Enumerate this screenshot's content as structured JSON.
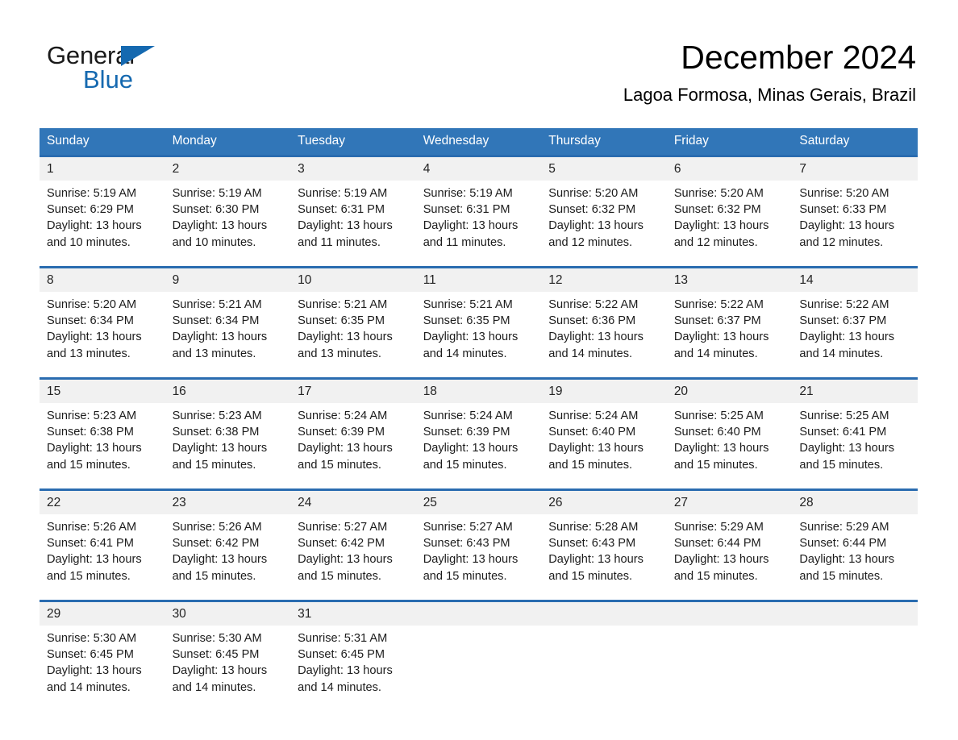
{
  "brand": {
    "name_part1": "General",
    "name_part2": "Blue",
    "accent_color": "#1569b0"
  },
  "header": {
    "month_title": "December 2024",
    "location": "Lagoa Formosa, Minas Gerais, Brazil"
  },
  "theme": {
    "header_blue": "#3176b8",
    "row_rule_blue": "#2a6cb0",
    "daynum_band": "#f1f1f1"
  },
  "weekday_headers": [
    "Sunday",
    "Monday",
    "Tuesday",
    "Wednesday",
    "Thursday",
    "Friday",
    "Saturday"
  ],
  "weeks": [
    [
      {
        "day": "1",
        "sunrise": "Sunrise: 5:19 AM",
        "sunset": "Sunset: 6:29 PM",
        "daylight": "Daylight: 13 hours and 10 minutes."
      },
      {
        "day": "2",
        "sunrise": "Sunrise: 5:19 AM",
        "sunset": "Sunset: 6:30 PM",
        "daylight": "Daylight: 13 hours and 10 minutes."
      },
      {
        "day": "3",
        "sunrise": "Sunrise: 5:19 AM",
        "sunset": "Sunset: 6:31 PM",
        "daylight": "Daylight: 13 hours and 11 minutes."
      },
      {
        "day": "4",
        "sunrise": "Sunrise: 5:19 AM",
        "sunset": "Sunset: 6:31 PM",
        "daylight": "Daylight: 13 hours and 11 minutes."
      },
      {
        "day": "5",
        "sunrise": "Sunrise: 5:20 AM",
        "sunset": "Sunset: 6:32 PM",
        "daylight": "Daylight: 13 hours and 12 minutes."
      },
      {
        "day": "6",
        "sunrise": "Sunrise: 5:20 AM",
        "sunset": "Sunset: 6:32 PM",
        "daylight": "Daylight: 13 hours and 12 minutes."
      },
      {
        "day": "7",
        "sunrise": "Sunrise: 5:20 AM",
        "sunset": "Sunset: 6:33 PM",
        "daylight": "Daylight: 13 hours and 12 minutes."
      }
    ],
    [
      {
        "day": "8",
        "sunrise": "Sunrise: 5:20 AM",
        "sunset": "Sunset: 6:34 PM",
        "daylight": "Daylight: 13 hours and 13 minutes."
      },
      {
        "day": "9",
        "sunrise": "Sunrise: 5:21 AM",
        "sunset": "Sunset: 6:34 PM",
        "daylight": "Daylight: 13 hours and 13 minutes."
      },
      {
        "day": "10",
        "sunrise": "Sunrise: 5:21 AM",
        "sunset": "Sunset: 6:35 PM",
        "daylight": "Daylight: 13 hours and 13 minutes."
      },
      {
        "day": "11",
        "sunrise": "Sunrise: 5:21 AM",
        "sunset": "Sunset: 6:35 PM",
        "daylight": "Daylight: 13 hours and 14 minutes."
      },
      {
        "day": "12",
        "sunrise": "Sunrise: 5:22 AM",
        "sunset": "Sunset: 6:36 PM",
        "daylight": "Daylight: 13 hours and 14 minutes."
      },
      {
        "day": "13",
        "sunrise": "Sunrise: 5:22 AM",
        "sunset": "Sunset: 6:37 PM",
        "daylight": "Daylight: 13 hours and 14 minutes."
      },
      {
        "day": "14",
        "sunrise": "Sunrise: 5:22 AM",
        "sunset": "Sunset: 6:37 PM",
        "daylight": "Daylight: 13 hours and 14 minutes."
      }
    ],
    [
      {
        "day": "15",
        "sunrise": "Sunrise: 5:23 AM",
        "sunset": "Sunset: 6:38 PM",
        "daylight": "Daylight: 13 hours and 15 minutes."
      },
      {
        "day": "16",
        "sunrise": "Sunrise: 5:23 AM",
        "sunset": "Sunset: 6:38 PM",
        "daylight": "Daylight: 13 hours and 15 minutes."
      },
      {
        "day": "17",
        "sunrise": "Sunrise: 5:24 AM",
        "sunset": "Sunset: 6:39 PM",
        "daylight": "Daylight: 13 hours and 15 minutes."
      },
      {
        "day": "18",
        "sunrise": "Sunrise: 5:24 AM",
        "sunset": "Sunset: 6:39 PM",
        "daylight": "Daylight: 13 hours and 15 minutes."
      },
      {
        "day": "19",
        "sunrise": "Sunrise: 5:24 AM",
        "sunset": "Sunset: 6:40 PM",
        "daylight": "Daylight: 13 hours and 15 minutes."
      },
      {
        "day": "20",
        "sunrise": "Sunrise: 5:25 AM",
        "sunset": "Sunset: 6:40 PM",
        "daylight": "Daylight: 13 hours and 15 minutes."
      },
      {
        "day": "21",
        "sunrise": "Sunrise: 5:25 AM",
        "sunset": "Sunset: 6:41 PM",
        "daylight": "Daylight: 13 hours and 15 minutes."
      }
    ],
    [
      {
        "day": "22",
        "sunrise": "Sunrise: 5:26 AM",
        "sunset": "Sunset: 6:41 PM",
        "daylight": "Daylight: 13 hours and 15 minutes."
      },
      {
        "day": "23",
        "sunrise": "Sunrise: 5:26 AM",
        "sunset": "Sunset: 6:42 PM",
        "daylight": "Daylight: 13 hours and 15 minutes."
      },
      {
        "day": "24",
        "sunrise": "Sunrise: 5:27 AM",
        "sunset": "Sunset: 6:42 PM",
        "daylight": "Daylight: 13 hours and 15 minutes."
      },
      {
        "day": "25",
        "sunrise": "Sunrise: 5:27 AM",
        "sunset": "Sunset: 6:43 PM",
        "daylight": "Daylight: 13 hours and 15 minutes."
      },
      {
        "day": "26",
        "sunrise": "Sunrise: 5:28 AM",
        "sunset": "Sunset: 6:43 PM",
        "daylight": "Daylight: 13 hours and 15 minutes."
      },
      {
        "day": "27",
        "sunrise": "Sunrise: 5:29 AM",
        "sunset": "Sunset: 6:44 PM",
        "daylight": "Daylight: 13 hours and 15 minutes."
      },
      {
        "day": "28",
        "sunrise": "Sunrise: 5:29 AM",
        "sunset": "Sunset: 6:44 PM",
        "daylight": "Daylight: 13 hours and 15 minutes."
      }
    ],
    [
      {
        "day": "29",
        "sunrise": "Sunrise: 5:30 AM",
        "sunset": "Sunset: 6:45 PM",
        "daylight": "Daylight: 13 hours and 14 minutes."
      },
      {
        "day": "30",
        "sunrise": "Sunrise: 5:30 AM",
        "sunset": "Sunset: 6:45 PM",
        "daylight": "Daylight: 13 hours and 14 minutes."
      },
      {
        "day": "31",
        "sunrise": "Sunrise: 5:31 AM",
        "sunset": "Sunset: 6:45 PM",
        "daylight": "Daylight: 13 hours and 14 minutes."
      },
      {
        "day": "",
        "sunrise": "",
        "sunset": "",
        "daylight": ""
      },
      {
        "day": "",
        "sunrise": "",
        "sunset": "",
        "daylight": ""
      },
      {
        "day": "",
        "sunrise": "",
        "sunset": "",
        "daylight": ""
      },
      {
        "day": "",
        "sunrise": "",
        "sunset": "",
        "daylight": ""
      }
    ]
  ]
}
